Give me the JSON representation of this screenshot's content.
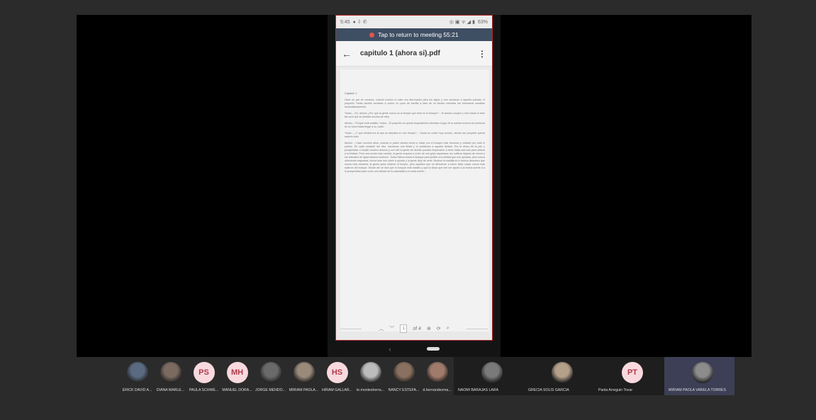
{
  "phone": {
    "status": {
      "time": "5:45",
      "battery": "63%"
    },
    "return_banner": "Tap to return to meeting 55:21",
    "title": "capitulo 1 (ahora si).pdf",
    "document": {
      "heading": "Capítulo 1",
      "paragraphs": [
        "Hace un par de veranos, cuando incluso el calor era abrumador para los lagos y ríos cercanos a aquella posada, el pequeño Yoska decidió sentarse a comer un poco de familia a lado de su abuelo mientras los chicharras sonaban escandalosamente.",
        "Yoska – Oh, abuelo ¿Por qué la gente nunca va al templo que está en el bosque? – El abuelo suspiró y miró hacia el cielo tan azul que se pintaba encima de ellos",
        "Abuelo – Porque está maldito, Yoska – El pequeño se quedó boquiabierto mientras el jugo de la sandía recorría la comisura de su boca hasta llegar a su cuello",
        "Yoska – ¿Y qué deidad era la que se adoraba en ese templo? – Yoska se volvió muy curioso, siendo tan pequeño quería saberlo todo",
        "Abuelo – Hace muchos años, cuando tu padre abuelo tenía tu edad, era el bosque más hermoso y visitado por todo el pueblo. En cada estación del año, hacíamos una fiesta y le pedíamos a aquella deidad. Era la diosa de la paz y prosperidad. Cumplió muchos deseos y con ello la gente de demás pueblos empezaron a venir hasta acá solo para adorar a la Deidad. Pero una noche todo cambió, la gente empezó a morir de una gripe espantosa, los cultivos dejaron de crecer y los animales de igual manera murieron. Todos fuimos hacia el bosque para pedirle a la deidad que nos ayudara, pero nunca obtuvimos respuesta, nunca más nos volvió a ayudar y la gente dejó de venir. Muchos la maldijeron e incluso desearon que nunca más existiera, la gente quiso destruir el templo, pero aquellos que se atrevieron a hacer tales cosas nunca más salieron del bosque. Desde ahí se dice que el bosque está maldito y que la diosa que ese ser ayudó a la buena suerte a a la prosperidad pasó a ser una deidad de la calamidad y la mala suerte –"
      ]
    },
    "pdf_nav": {
      "page": "1",
      "of": "of 4"
    }
  },
  "participants": [
    {
      "name": "ERICK DAVID A...",
      "initials": "",
      "photo": true
    },
    {
      "name": "DIANA MARLE...",
      "initials": "",
      "photo": true
    },
    {
      "name": "PAULA SCHWE...",
      "initials": "PS",
      "photo": false
    },
    {
      "name": "MANUEL DORA...",
      "initials": "MH",
      "photo": false
    },
    {
      "name": "JORGE MENDO...",
      "initials": "",
      "photo": true
    },
    {
      "name": "MIRIAM PAOLA...",
      "initials": "",
      "photo": true
    },
    {
      "name": "HIRAM GALLAR...",
      "initials": "HS",
      "photo": false
    },
    {
      "name": "le.montesherra...",
      "initials": "",
      "photo": true
    },
    {
      "name": "NANCY ESTEFA...",
      "initials": "",
      "photo": true
    },
    {
      "name": "d.hernandezma...",
      "initials": "",
      "photo": true
    },
    {
      "name": "NAOMI BARAJAS LARA",
      "initials": "",
      "photo": true
    },
    {
      "name": "GRECIA SOLIS GARCIA",
      "initials": "",
      "photo": true
    },
    {
      "name": "Paola Arreguin Tovar",
      "initials": "PT",
      "photo": false
    },
    {
      "name": "MIRIAM PAOLA VARELA TORRES",
      "initials": "",
      "photo": true
    }
  ],
  "colors": {
    "banner": "#3e4e63",
    "record_dot": "#e3534c",
    "border": "#b22a2a",
    "active_tile": "#3c3f55"
  }
}
